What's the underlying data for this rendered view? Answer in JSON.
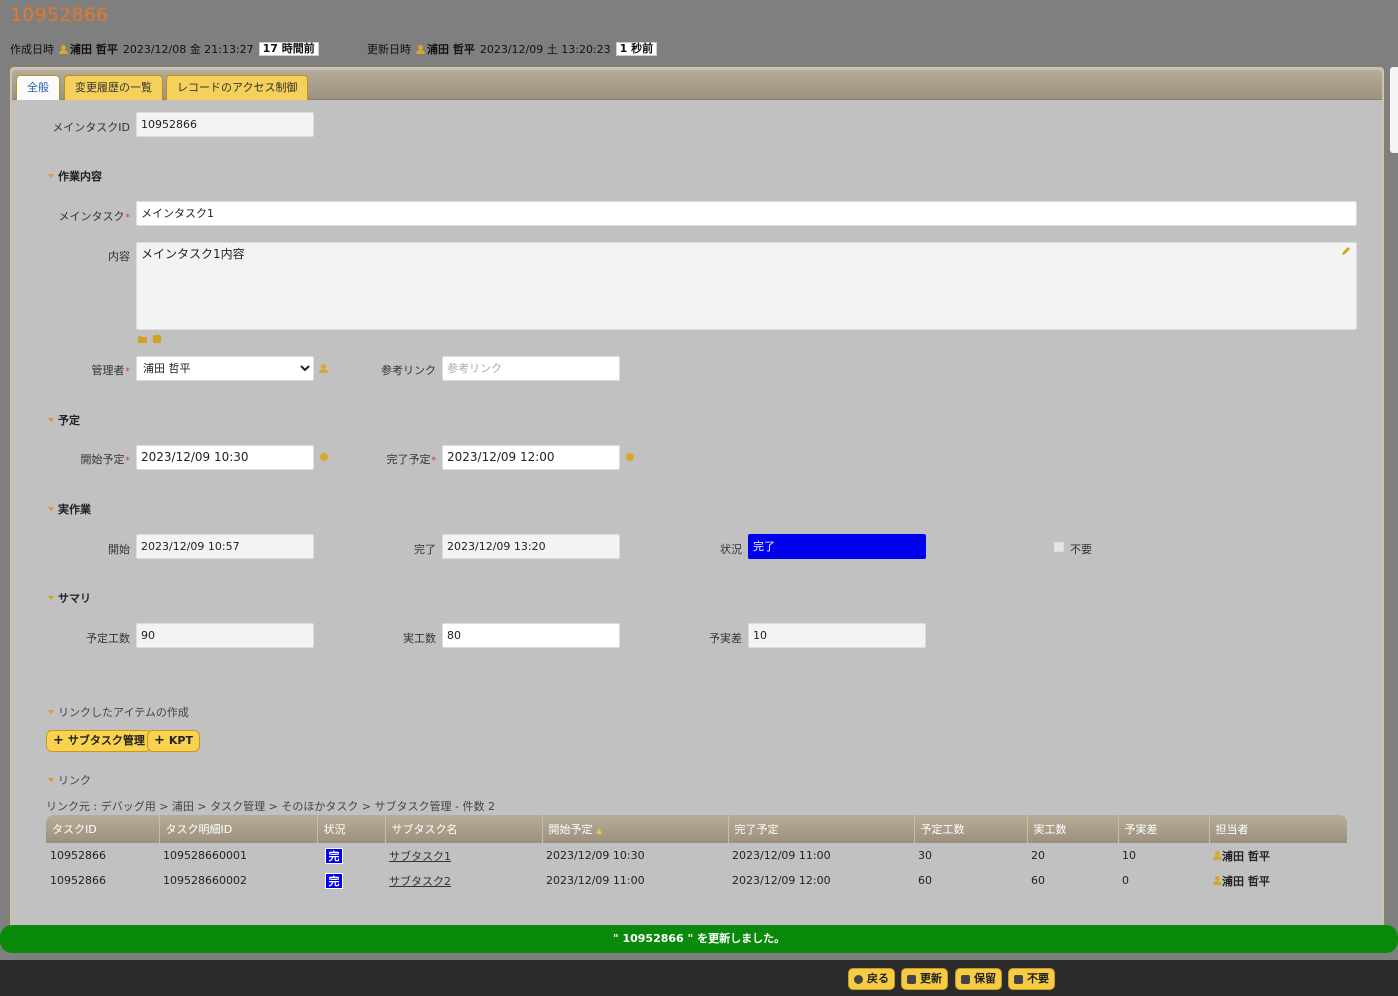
{
  "header": {
    "record_id": "10952866",
    "created_label": "作成日時",
    "created_user": "浦田 哲平",
    "created_at": "2023/12/08 金 21:13:27",
    "created_ago": "17 時間前",
    "updated_label": "更新日時",
    "updated_user": "浦田 哲平",
    "updated_at": "2023/12/09 土 13:20:23",
    "updated_ago": "1 秒前"
  },
  "tabs": [
    "全般",
    "変更履歴の一覧",
    "レコードのアクセス制御"
  ],
  "form": {
    "main_task_id_label": "メインタスクID",
    "main_task_id": "10952866",
    "section_work": "作業内容",
    "main_task_label": "メインタスク",
    "main_task": "メインタスク1",
    "content_label": "内容",
    "content": "メインタスク1内容",
    "manager_label": "管理者",
    "manager": "浦田 哲平",
    "ref_link_label": "参考リンク",
    "ref_link_placeholder": "参考リンク",
    "section_plan": "予定",
    "plan_start_label": "開始予定",
    "plan_start": "2023/12/09 10:30",
    "plan_end_label": "完了予定",
    "plan_end": "2023/12/09 12:00",
    "section_actual": "実作業",
    "start_label": "開始",
    "start": "2023/12/09 10:57",
    "end_label": "完了",
    "end": "2023/12/09 13:20",
    "status_label": "状況",
    "status": "完了",
    "status_color": "#0000ee",
    "unneeded_label": "不要",
    "section_summary": "サマリ",
    "planned_hours_label": "予定工数",
    "planned_hours": "90",
    "actual_hours_label": "実工数",
    "actual_hours": "80",
    "diff_label": "予実差",
    "diff": "10"
  },
  "linked": {
    "create_heading": "リンクしたアイテムの作成",
    "btn_subtask": "サブタスク管理",
    "btn_kpt": "KPT",
    "links_heading": "リンク",
    "breadcrumb": "リンク元 : デバッグ用 > 浦田 > タスク管理 > そのほかタスク > サブタスク管理 - 件数 2",
    "columns": [
      "タスクID",
      "タスク明細ID",
      "状況",
      "サブタスク名",
      "開始予定",
      "完了予定",
      "予定工数",
      "実工数",
      "予実差",
      "担当者"
    ],
    "rows": [
      {
        "task_id": "10952866",
        "detail_id": "109528660001",
        "status": "完",
        "name": "サブタスク1",
        "plan_start": "2023/12/09 10:30",
        "plan_end": "2023/12/09 11:00",
        "planned": "30",
        "actual": "20",
        "diff": "10",
        "owner": "浦田 哲平"
      },
      {
        "task_id": "10952866",
        "detail_id": "109528660002",
        "status": "完",
        "name": "サブタスク2",
        "plan_start": "2023/12/09 11:00",
        "plan_end": "2023/12/09 12:00",
        "planned": "60",
        "actual": "60",
        "diff": "0",
        "owner": "浦田 哲平"
      }
    ]
  },
  "toast": "\" 10952866 \" を更新しました。",
  "footer": {
    "back": "戻る",
    "update": "更新",
    "hold": "保留",
    "unneeded": "不要"
  },
  "colors": {
    "record_id": "#e8762b",
    "toast": "#0a8a0a",
    "accent": "#f9d34f"
  }
}
